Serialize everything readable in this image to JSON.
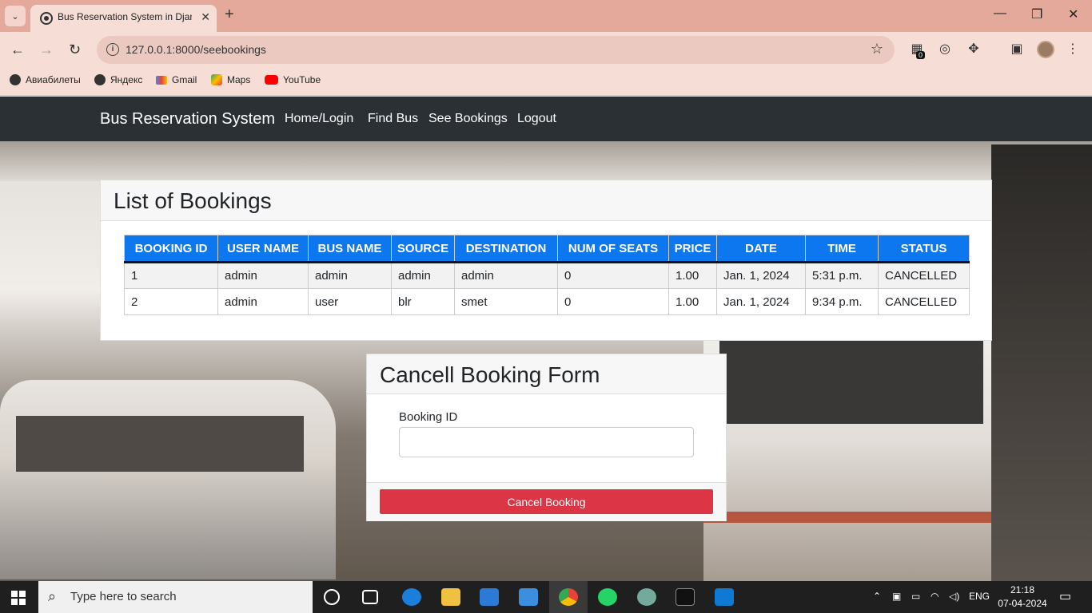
{
  "browser": {
    "tab_title": "Bus Reservation System in Djan",
    "url": "127.0.0.1:8000/seebookings",
    "bookmarks": [
      {
        "label": "Авиабилеты",
        "icon": "globe-icon"
      },
      {
        "label": "Яндекс",
        "icon": "globe-icon"
      },
      {
        "label": "Gmail",
        "icon": "gmail-icon"
      },
      {
        "label": "Maps",
        "icon": "maps-icon"
      },
      {
        "label": "YouTube",
        "icon": "youtube-icon"
      }
    ],
    "extension_badge": "0"
  },
  "navbar": {
    "brand": "Bus Reservation System",
    "links": [
      "Home/Login",
      "Find Bus",
      "See Bookings",
      "Logout"
    ]
  },
  "bookings": {
    "title": "List of Bookings",
    "columns": [
      "BOOKING ID",
      "USER NAME",
      "BUS NAME",
      "SOURCE",
      "DESTINATION",
      "NUM OF SEATS",
      "PRICE",
      "DATE",
      "TIME",
      "STATUS"
    ],
    "rows": [
      [
        "1",
        "admin",
        "admin",
        "admin",
        "admin",
        "0",
        "1.00",
        "Jan. 1, 2024",
        "5:31 p.m.",
        "CANCELLED"
      ],
      [
        "2",
        "admin",
        "user",
        "blr",
        "smet",
        "0",
        "1.00",
        "Jan. 1, 2024",
        "9:34 p.m.",
        "CANCELLED"
      ]
    ]
  },
  "cancel_form": {
    "title": "Cancell Booking Form",
    "field_label": "Booking ID",
    "field_value": "",
    "button_label": "Cancel Booking"
  },
  "taskbar": {
    "search_placeholder": "Type here to search",
    "language": "ENG",
    "time": "21:18",
    "date": "07-04-2024"
  },
  "colors": {
    "table_header": "#0d77f0",
    "navbar": "#2b3035",
    "cancel_button": "#dc3545",
    "tabstrip": "#e5a99b"
  }
}
